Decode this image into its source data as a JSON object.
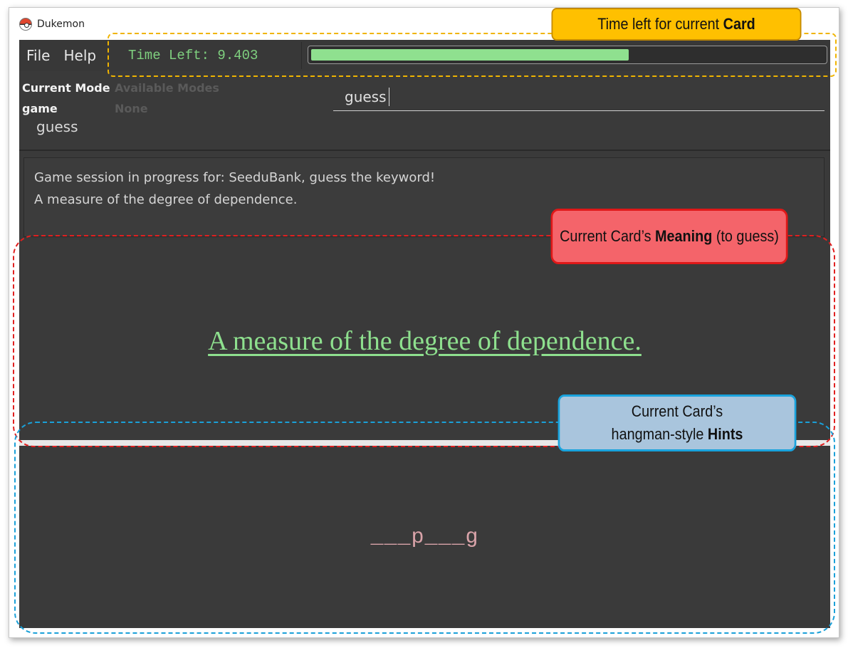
{
  "window": {
    "title": "Dukemon"
  },
  "menu": [
    {
      "label": "File"
    },
    {
      "label": "Help"
    }
  ],
  "timer": {
    "text": "Time Left: 9.403",
    "progress_fraction": 0.62
  },
  "mode": {
    "current_label": "Current Mode",
    "current_value": "game",
    "available_label": "Available Modes",
    "available_value": "None",
    "last_command": "guess"
  },
  "command_input": {
    "value": "guess"
  },
  "result": {
    "lines": [
      "Game session in progress for: SeeduBank, guess the keyword!",
      "A measure of the degree of dependence."
    ]
  },
  "card": {
    "meaning": "A measure of the degree of dependence.",
    "hint": "___p___g"
  },
  "annotations": {
    "timer": {
      "prefix": "Time left for current ",
      "bold": "Card"
    },
    "meaning": {
      "prefix": "Current Card’s ",
      "bold": "Meaning",
      "suffix": " (to guess)"
    },
    "hints": {
      "line1": "Current Card’s",
      "prefix": "hangman-style ",
      "bold": "Hints"
    }
  },
  "colors": {
    "app_bg": "#3a3a3a",
    "timer_text": "#7fd07f",
    "progress_fill": "#8fe08f",
    "meaning_text": "#8ee08e",
    "hint_text": "#d9a3a9",
    "callout_yellow": "#ffc000",
    "callout_red": "#f4646a",
    "callout_blue": "#a9c5dd"
  },
  "icons": {
    "app": "pokeball-icon"
  }
}
